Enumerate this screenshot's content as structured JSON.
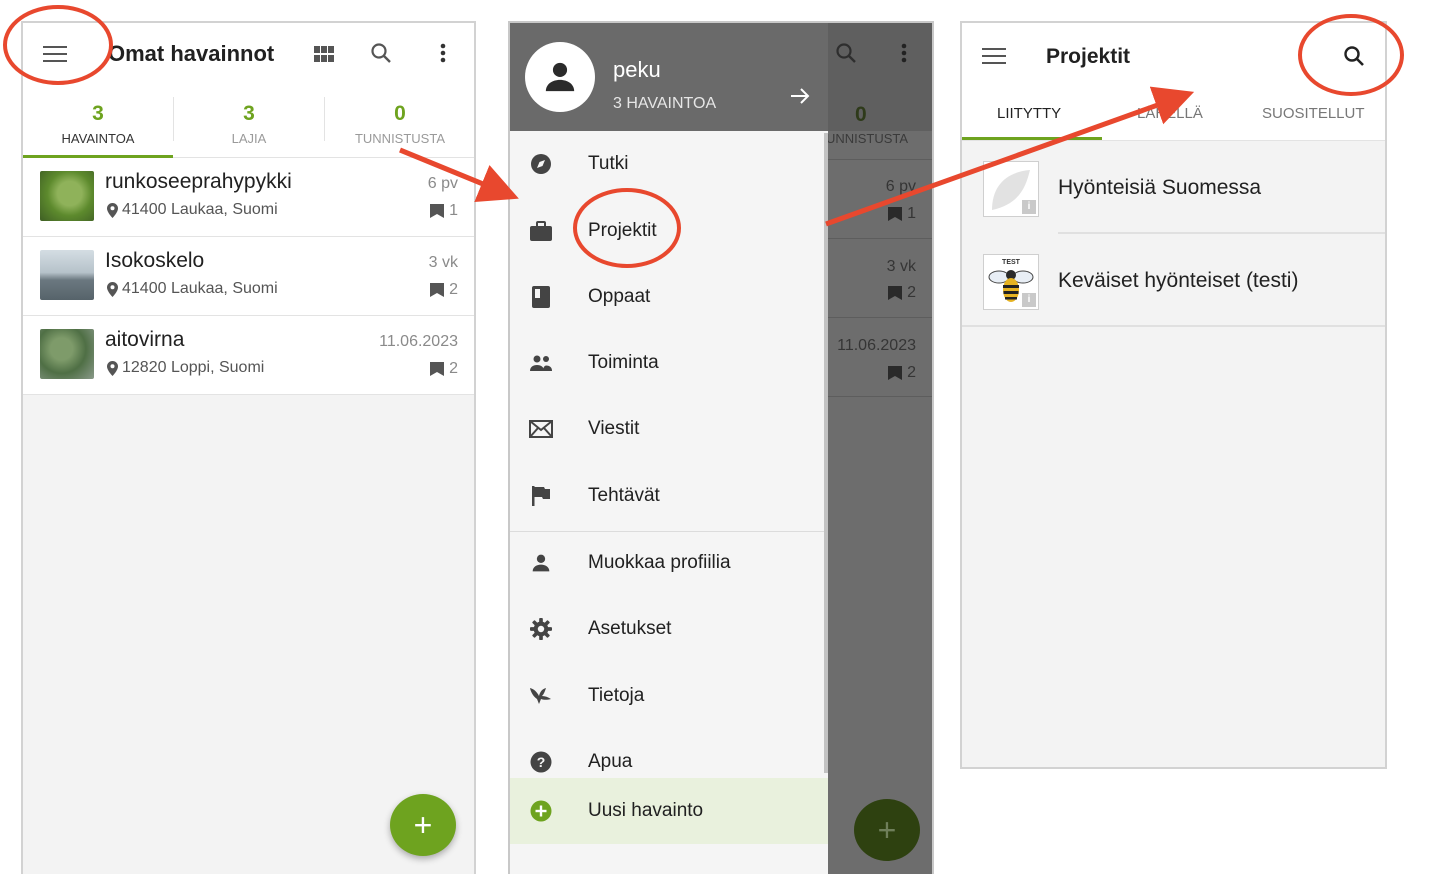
{
  "panel1": {
    "title": "Omat havainnot",
    "stats": [
      {
        "count": "3",
        "label": "HAVAINTOA"
      },
      {
        "count": "3",
        "label": "LAJIA"
      },
      {
        "count": "0",
        "label": "TUNNISTUSTA"
      }
    ],
    "observations": [
      {
        "name": "runkoseeprahypykki",
        "location": "41400 Laukaa, Suomi",
        "age": "6 pv",
        "count": "1"
      },
      {
        "name": "Isokoskelo",
        "location": "41400 Laukaa, Suomi",
        "age": "3 vk",
        "count": "2"
      },
      {
        "name": "aitovirna",
        "location": "12820 Loppi, Suomi",
        "age": "11.06.2023",
        "count": "2"
      }
    ],
    "fab_label": "+"
  },
  "panel2": {
    "user": {
      "name": "peku",
      "count_label": "3 HAVAINTOA"
    },
    "menu": [
      {
        "label": "Tutki",
        "icon": "compass-icon"
      },
      {
        "label": "Projektit",
        "icon": "briefcase-icon"
      },
      {
        "label": "Oppaat",
        "icon": "book-icon"
      },
      {
        "label": "Toiminta",
        "icon": "people-icon"
      },
      {
        "label": "Viestit",
        "icon": "mail-icon"
      },
      {
        "label": "Tehtävät",
        "icon": "flag-icon"
      },
      {
        "label": "Muokkaa profiilia",
        "icon": "person-icon"
      },
      {
        "label": "Asetukset",
        "icon": "gear-icon"
      },
      {
        "label": "Tietoja",
        "icon": "bird-icon"
      },
      {
        "label": "Apua",
        "icon": "help-icon"
      }
    ],
    "new_observation": "Uusi havainto",
    "background": {
      "count": "0",
      "label": "TUNNISTUSTA",
      "rows": [
        {
          "age": "6 pv",
          "count": "1"
        },
        {
          "age": "3 vk",
          "count": "2"
        },
        {
          "age": "11.06.2023",
          "count": "2"
        }
      ],
      "fab_label": "+"
    }
  },
  "panel3": {
    "title": "Projektit",
    "tabs": [
      "LIITYTTY",
      "LÄHELLÄ",
      "SUOSITELLUT"
    ],
    "projects": [
      {
        "name": "Hyönteisiä Suomessa"
      },
      {
        "name": "Keväiset hyönteiset (testi)",
        "logo_text": "TEST"
      }
    ]
  },
  "colors": {
    "accent": "#6ea31f",
    "annotation": "#e8482e"
  }
}
